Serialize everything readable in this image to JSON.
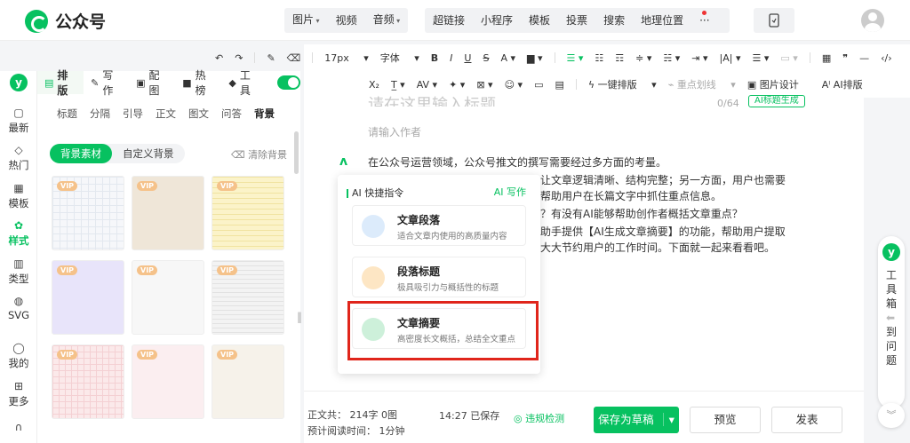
{
  "header": {
    "logo_text": "公众号",
    "insert_menu": [
      "图片",
      "视频",
      "音频"
    ],
    "tool_menu": [
      "超链接",
      "小程序",
      "模板",
      "投票",
      "搜索",
      "地理位置"
    ],
    "more": "···"
  },
  "toolbar": {
    "font_size": "17px",
    "font_family": "字体",
    "one_click_layout": "一键排版",
    "highlight_line": "重点划线",
    "image_design": "图片设计",
    "ai_layout": "AI排版"
  },
  "left_rail": {
    "badge": "y",
    "items": [
      {
        "icon": "▢",
        "label": "最新"
      },
      {
        "icon": "◇",
        "label": "热门"
      },
      {
        "icon": "▦",
        "label": "模板"
      },
      {
        "icon": "✿",
        "label": "样式"
      },
      {
        "icon": "▥",
        "label": "类型"
      },
      {
        "icon": "◍",
        "label": "SVG"
      },
      {
        "icon": "◯",
        "label": "我的"
      },
      {
        "icon": "⊞",
        "label": "更多"
      }
    ]
  },
  "panel": {
    "tabs": [
      {
        "icon": "▤",
        "label": "排版"
      },
      {
        "icon": "✎",
        "label": "写作"
      },
      {
        "icon": "▣",
        "label": "配图"
      },
      {
        "icon": "■",
        "label": "热榜"
      },
      {
        "icon": "◆",
        "label": "工具"
      }
    ],
    "sub_tabs": [
      "标题",
      "分隔",
      "引导",
      "正文",
      "图文",
      "问答",
      "背景"
    ],
    "segments": [
      "背景素材",
      "自定义背景"
    ],
    "clear_label": "清除背景",
    "vip_label": "VIP",
    "tile_colors": [
      "#f6f7fa",
      "#efe6d8",
      "#fbf3c9",
      "#e8e4fa",
      "#f7f7f7",
      "#f3f3f3",
      "#fbe9ea",
      "#fbeef0",
      "#f6f2ea"
    ]
  },
  "editor": {
    "title_placeholder": "请在这里输入标题",
    "title_count": "0/64",
    "ai_title_button": "AI标题生成",
    "author_placeholder": "请输入作者",
    "ai_marker": "ʌ",
    "body_lines": [
      "在公众号运营领域，公众号推文的撰写需要经过多方面的考量。",
      "让文章逻辑清晰、结构完整；另一方面，用户也需要",
      "帮助用户在长篇文字中抓住重点信息。",
      "？有没有AI能够帮助创作者概括文章重点？",
      "助手提供【AI生成文章摘要】的功能，帮助用户提取",
      "大大节约用户的工作时间。下面就一起来看看吧。"
    ]
  },
  "ai_popup": {
    "heading": "AI 快捷指令",
    "write_link": "AI 写作",
    "cards": [
      {
        "title": "文章段落",
        "desc": "适合文章内使用的高质量内容",
        "color": "#e6f0fb"
      },
      {
        "title": "段落标题",
        "desc": "极具吸引力与概括性的标题",
        "color": "#fcefd9"
      },
      {
        "title": "文章摘要",
        "desc": "高密度长文概括，总结全文重点",
        "color": "#e2f6e9"
      }
    ]
  },
  "footer": {
    "word_count_label": "正文共：",
    "word_count_value": "214字 0图",
    "read_time_label": "预计阅读时间：",
    "read_time_value": "1分钟",
    "saved_status": "14:27  已保存",
    "check_label": "违规检测",
    "save_draft": "保存为草稿",
    "preview": "预览",
    "publish": "发表"
  },
  "right_helper": {
    "badge": "y",
    "toolbox": "工具箱",
    "to_question": "到问题"
  }
}
